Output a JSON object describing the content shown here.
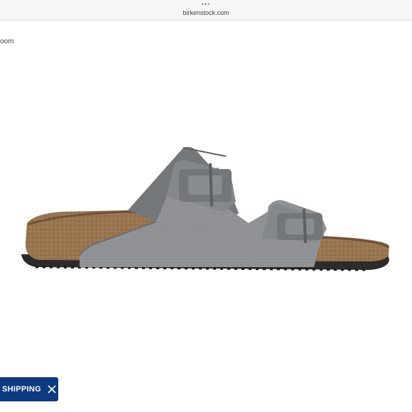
{
  "browser": {
    "menu_dots": "•••",
    "url": "birkenstock.com"
  },
  "page": {
    "zoom_label": "oom"
  },
  "product": {
    "image_icon": "sandal-image",
    "colors": {
      "upper": "#8f9295",
      "footbed": "#9a7651",
      "sole": "#2b2b2b"
    }
  },
  "banner": {
    "label": "SHIPPING",
    "close_icon": "close-icon",
    "background": "#0d3a80"
  }
}
